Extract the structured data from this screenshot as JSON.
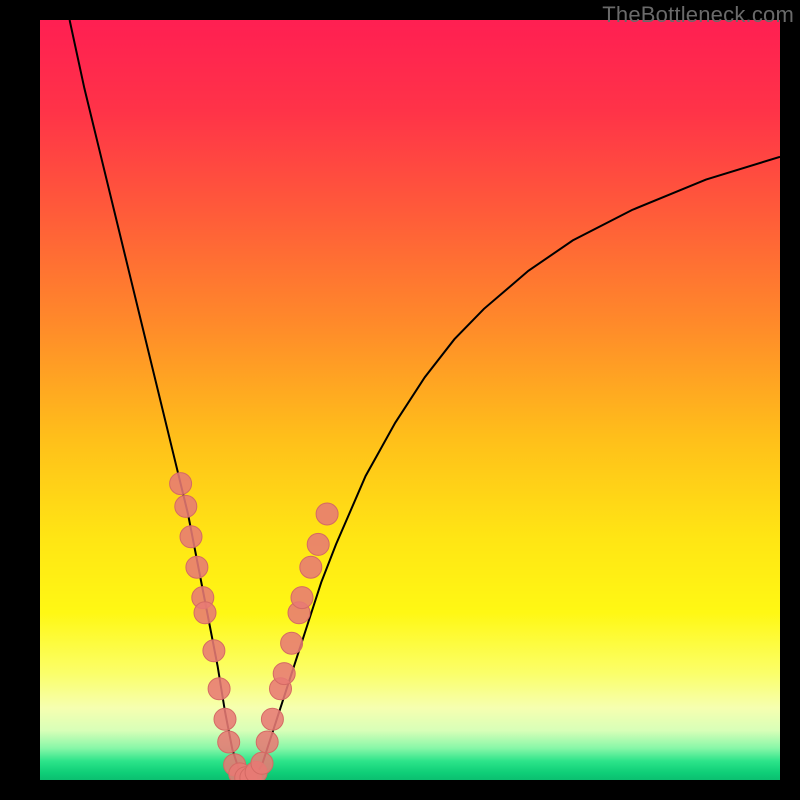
{
  "watermark": "TheBottleneck.com",
  "colors": {
    "curve": "#000000",
    "marker_fill": "#e77a74",
    "marker_stroke": "#d46a64",
    "frame": "#000000"
  },
  "gradient_stops": [
    {
      "offset": 0.0,
      "color": "#ff1f52"
    },
    {
      "offset": 0.12,
      "color": "#ff3348"
    },
    {
      "offset": 0.25,
      "color": "#ff5a3a"
    },
    {
      "offset": 0.4,
      "color": "#ff8a2a"
    },
    {
      "offset": 0.55,
      "color": "#ffbf1a"
    },
    {
      "offset": 0.68,
      "color": "#ffe514"
    },
    {
      "offset": 0.78,
      "color": "#fff814"
    },
    {
      "offset": 0.86,
      "color": "#fbff6a"
    },
    {
      "offset": 0.905,
      "color": "#f6ffb0"
    },
    {
      "offset": 0.935,
      "color": "#d8ffb8"
    },
    {
      "offset": 0.958,
      "color": "#88f7a8"
    },
    {
      "offset": 0.975,
      "color": "#2de48a"
    },
    {
      "offset": 0.99,
      "color": "#0fcf78"
    },
    {
      "offset": 1.0,
      "color": "#0bbf70"
    }
  ],
  "chart_data": {
    "type": "line",
    "title": "",
    "xlabel": "",
    "ylabel": "",
    "xlim": [
      0,
      100
    ],
    "ylim": [
      0,
      100
    ],
    "series": [
      {
        "name": "bottleneck-curve",
        "x": [
          4,
          6,
          8,
          10,
          12,
          14,
          16,
          18,
          20,
          21,
          22,
          23,
          24,
          25,
          26,
          27,
          28,
          29,
          30,
          31,
          32,
          34,
          36,
          38,
          40,
          44,
          48,
          52,
          56,
          60,
          66,
          72,
          80,
          90,
          100
        ],
        "y": [
          100,
          91,
          83,
          75,
          67,
          59,
          51,
          43,
          35,
          30,
          25,
          20,
          15,
          9,
          4,
          1,
          0,
          0.5,
          2,
          5,
          8,
          14,
          20,
          26,
          31,
          40,
          47,
          53,
          58,
          62,
          67,
          71,
          75,
          79,
          82
        ]
      }
    ],
    "markers": {
      "name": "sample-points",
      "points": [
        {
          "x": 19.0,
          "y": 39
        },
        {
          "x": 19.7,
          "y": 36
        },
        {
          "x": 20.4,
          "y": 32
        },
        {
          "x": 21.2,
          "y": 28
        },
        {
          "x": 22.0,
          "y": 24
        },
        {
          "x": 22.3,
          "y": 22
        },
        {
          "x": 23.5,
          "y": 17
        },
        {
          "x": 24.2,
          "y": 12
        },
        {
          "x": 25.0,
          "y": 8
        },
        {
          "x": 25.5,
          "y": 5
        },
        {
          "x": 26.3,
          "y": 2
        },
        {
          "x": 27.0,
          "y": 0.8
        },
        {
          "x": 27.8,
          "y": 0.3
        },
        {
          "x": 28.5,
          "y": 0.3
        },
        {
          "x": 29.2,
          "y": 1.0
        },
        {
          "x": 30.0,
          "y": 2.2
        },
        {
          "x": 30.7,
          "y": 5
        },
        {
          "x": 31.4,
          "y": 8
        },
        {
          "x": 32.5,
          "y": 12
        },
        {
          "x": 33.0,
          "y": 14
        },
        {
          "x": 34.0,
          "y": 18
        },
        {
          "x": 35.0,
          "y": 22
        },
        {
          "x": 35.4,
          "y": 24
        },
        {
          "x": 36.6,
          "y": 28
        },
        {
          "x": 37.6,
          "y": 31
        },
        {
          "x": 38.8,
          "y": 35
        }
      ]
    }
  }
}
